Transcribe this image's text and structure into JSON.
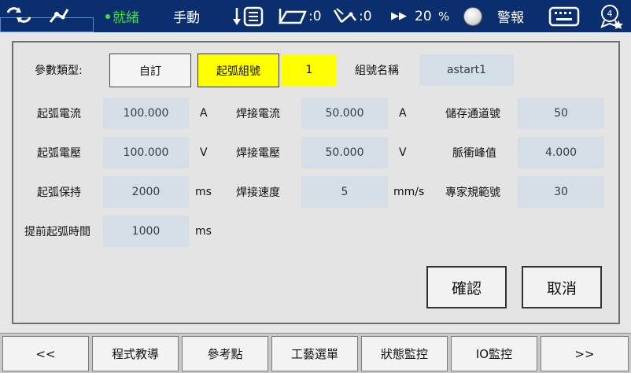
{
  "status_bar": {
    "state": "就緒",
    "mode": "手動",
    "tool_count": ":0",
    "user_count": ":0",
    "speed_value": "20",
    "speed_unit": "%",
    "alarm_label": "警報",
    "page_badge": "4"
  },
  "form": {
    "param_type_label": "參數類型:",
    "type_custom": "自訂",
    "type_arc_group": "起弧組號",
    "group_number": "1",
    "group_name_label": "組號名稱",
    "group_name_value": "astart1",
    "arc_current_label": "起弧電流",
    "arc_current_value": "100.000",
    "arc_current_unit": "A",
    "weld_current_label": "焊接電流",
    "weld_current_value": "50.000",
    "weld_current_unit": "A",
    "storage_channel_label": "儲存通道號",
    "storage_channel_value": "50",
    "arc_voltage_label": "起弧電壓",
    "arc_voltage_value": "100.000",
    "arc_voltage_unit": "V",
    "weld_voltage_label": "焊接電壓",
    "weld_voltage_value": "50.000",
    "weld_voltage_unit": "V",
    "pulse_peak_label": "脈衝峰值",
    "pulse_peak_value": "4.000",
    "arc_hold_label": "起弧保持",
    "arc_hold_value": "2000",
    "arc_hold_unit": "ms",
    "weld_speed_label": "焊接速度",
    "weld_speed_value": "5",
    "weld_speed_unit": "mm/s",
    "expert_spec_label": "專家規範號",
    "expert_spec_value": "30",
    "pre_arc_time_label": "提前起弧時間",
    "pre_arc_time_value": "1000",
    "pre_arc_time_unit": "ms",
    "confirm_label": "確認",
    "cancel_label": "取消"
  },
  "nav": {
    "prev": "<<",
    "program_teach": "程式教導",
    "ref_point": "參考點",
    "process_menu": "工藝選單",
    "status_monitor": "狀態監控",
    "io_monitor": "IO監控",
    "next": ">>"
  },
  "colors": {
    "status_bg": "#0b2e6e",
    "ready_green": "#3ee03e",
    "field_bg": "#d5dde6",
    "highlight_yellow": "#ffff00"
  }
}
